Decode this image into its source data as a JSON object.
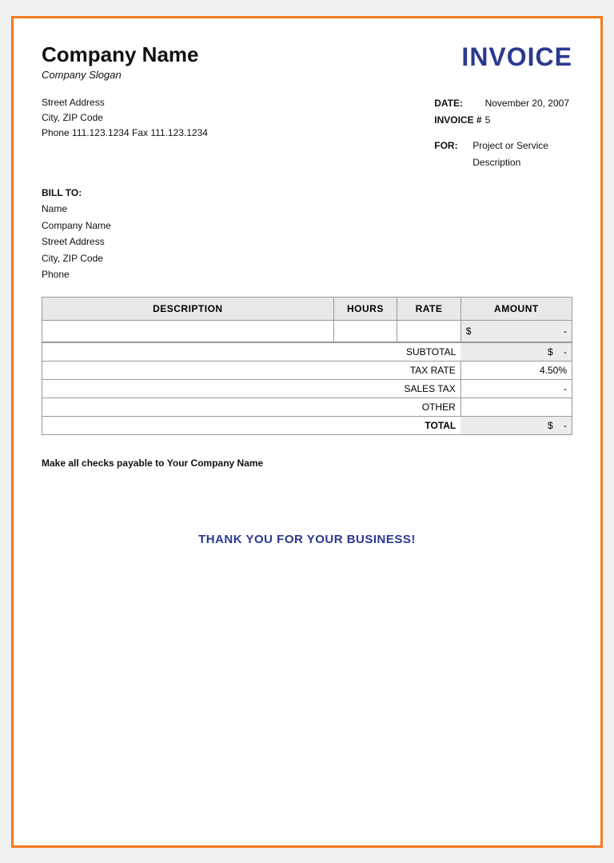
{
  "page": {
    "border_color": "#f47a20"
  },
  "header": {
    "company_name": "Company Name",
    "company_slogan": "Company Slogan",
    "invoice_title": "INVOICE"
  },
  "address": {
    "street": "Street Address",
    "city_zip": "City, ZIP Code",
    "phone_fax": "Phone 111.123.1234   Fax 111.123.1234"
  },
  "date_info": {
    "date_label": "DATE:",
    "date_value": "November 20, 2007",
    "invoice_label": "INVOICE #",
    "invoice_value": "5",
    "for_label": "FOR:",
    "for_description_line1": "Project or Service",
    "for_description_line2": "Description"
  },
  "bill_to": {
    "label": "BILL TO:",
    "name": "Name",
    "company": "Company Name",
    "street": "Street Address",
    "city_zip": "City, ZIP Code",
    "phone": "Phone"
  },
  "table": {
    "col_description": "DESCRIPTION",
    "col_hours": "HOURS",
    "col_rate": "RATE",
    "col_amount": "AMOUNT",
    "amount_symbol": "$",
    "amount_dash": "-"
  },
  "subtotals": {
    "subtotal_label": "SUBTOTAL",
    "subtotal_symbol": "$",
    "subtotal_value": "-",
    "tax_rate_label": "TAX RATE",
    "tax_rate_value": "4.50%",
    "sales_tax_label": "SALES TAX",
    "sales_tax_value": "-",
    "other_label": "OTHER",
    "other_value": "",
    "total_label": "TOTAL",
    "total_symbol": "$",
    "total_value": "-"
  },
  "footer": {
    "note_prefix": "Make all checks payable to",
    "note_bold": "Your Company Name",
    "thank_you": "THANK YOU FOR YOUR BUSINESS!"
  }
}
